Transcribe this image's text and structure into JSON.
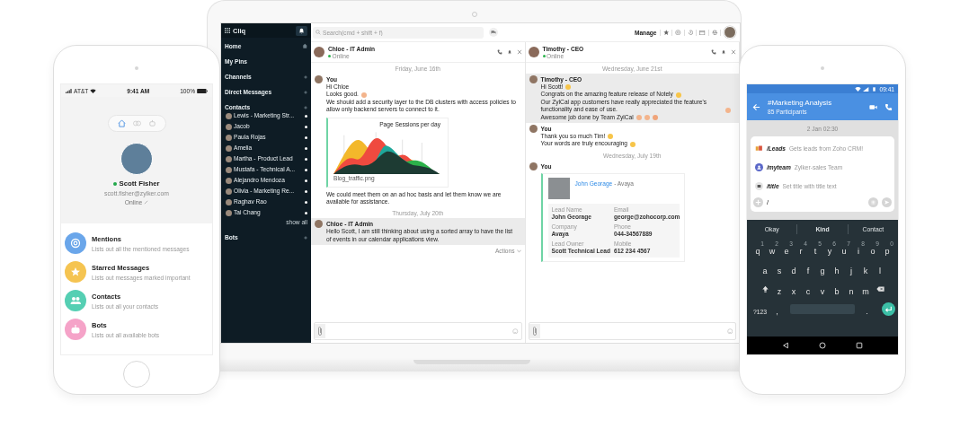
{
  "left_phone": {
    "status_bar": {
      "carrier": "AT&T",
      "time": "9:41 AM",
      "battery": "100%"
    },
    "tabs": [
      {
        "kind": "home",
        "selected": true
      },
      {
        "kind": "chats",
        "selected": false
      },
      {
        "kind": "bots",
        "selected": false
      }
    ],
    "profile": {
      "name": "Scott Fisher",
      "online": true,
      "email": "scott.fisher@zylker.com",
      "status": "Online"
    },
    "menu": [
      {
        "kind": "mentions",
        "title": "Mentions",
        "subtitle": "Lists out all the mentioned messages",
        "color": "#6aa6ea"
      },
      {
        "kind": "starred",
        "title": "Starred Messages",
        "subtitle": "Lists out messages marked important",
        "color": "#f5c451"
      },
      {
        "kind": "contacts",
        "title": "Contacts",
        "subtitle": "Lists out all your contacts",
        "color": "#55cfb3"
      },
      {
        "kind": "bots",
        "title": "Bots",
        "subtitle": "Lists out all available bots",
        "color": "#f5a3c8"
      }
    ]
  },
  "laptop": {
    "sidebar": {
      "app_name": "Cliq",
      "items": [
        {
          "kind": "home",
          "label": "Home"
        },
        {
          "kind": "plain",
          "label": "My Pins"
        },
        {
          "kind": "section",
          "label": "Channels"
        },
        {
          "kind": "section",
          "label": "Direct Messages"
        },
        {
          "kind": "section",
          "label": "Contacts",
          "children": [
            {
              "name": "Lewis - Marketing Str..."
            },
            {
              "name": "Jacob"
            },
            {
              "name": "Paula Rojas"
            },
            {
              "name": "Amelia"
            },
            {
              "name": "Martha - Product Lead"
            },
            {
              "name": "Mustafa - Technical A..."
            },
            {
              "name": "Alejandro Mendoza"
            },
            {
              "name": "Olivia - Marketing Re..."
            },
            {
              "name": "Raghav Rao"
            },
            {
              "name": "Tai Chang"
            }
          ],
          "more": "show all"
        },
        {
          "kind": "section",
          "label": "Bots"
        }
      ]
    },
    "toolbar": {
      "search_placeholder": "Search(cmd + shift + f)",
      "manage": "Manage"
    },
    "chats": [
      {
        "contact": "Chloe - IT Admin",
        "status": "Online",
        "actions": "Actions",
        "timeline": [
          {
            "kind": "date",
            "text": "Friday, June 16th"
          },
          {
            "kind": "message",
            "sender": "You",
            "highlighted": false,
            "blocks": [
              {
                "kind": "line",
                "text": "Hi Chloe"
              },
              {
                "kind": "line",
                "text": "Looks good.",
                "emojis": [
                  {
                    "kind": "hand"
                  }
                ]
              },
              {
                "kind": "line",
                "text": "We should add a security layer to the DB clusters with access policies to allow only backend servers to connect to it."
              },
              {
                "kind": "image",
                "title": "Page Sessions per day",
                "file": "Blog_traffic.png"
              },
              {
                "kind": "line",
                "text": "We could meet them on an ad hoc basis and let them know we are available for assistance."
              }
            ]
          },
          {
            "kind": "date",
            "text": "Thursday, July 20th"
          },
          {
            "kind": "message",
            "sender": "Chloe - IT Admin",
            "highlighted": true,
            "blocks": [
              {
                "kind": "line",
                "text": "Hello Scott, I am still thinking about using a sorted array to have the list of events in our calendar applications view."
              }
            ]
          }
        ]
      },
      {
        "contact": "Timothy - CEO",
        "status": "Online",
        "timeline": [
          {
            "kind": "date",
            "text": "Wednesday, June 21st"
          },
          {
            "kind": "message",
            "sender": "Timothy - CEO",
            "highlighted": true,
            "blocks": [
              {
                "kind": "line",
                "text": "Hi Scott!",
                "emojis": [
                  {
                    "kind": "smile"
                  }
                ]
              },
              {
                "kind": "line",
                "text": "Congrats on the amazing feature release of Notely",
                "emojis": [
                  {
                    "kind": "cool"
                  }
                ]
              },
              {
                "kind": "line",
                "text": "Our ZylCal app customers have really appreciated the feature's functionality and ease of use.",
                "emojis": [
                  {
                    "kind": "clap"
                  }
                ]
              },
              {
                "kind": "line",
                "text": "Awesome job done by Team ZylCal",
                "emojis": [
                  {
                    "kind": "hand"
                  },
                  {
                    "kind": "clap"
                  },
                  {
                    "kind": "party"
                  }
                ]
              }
            ]
          },
          {
            "kind": "message",
            "sender": "You",
            "highlighted": false,
            "blocks": [
              {
                "kind": "line",
                "text": "Thank you so much Tim!",
                "emojis": [
                  {
                    "kind": "smile"
                  }
                ]
              },
              {
                "kind": "line",
                "text": "Your words are truly encouraging",
                "emojis": [
                  {
                    "kind": "angel"
                  }
                ]
              }
            ]
          },
          {
            "kind": "date",
            "text": "Wednesday, July 19th"
          },
          {
            "kind": "message",
            "sender": "You",
            "highlighted": false,
            "blocks": [
              {
                "kind": "lead_card",
                "name": "John Georage",
                "company": "- Avaya",
                "fields": [
                  {
                    "label": "Lead Name",
                    "value": "John Georage"
                  },
                  {
                    "label": "Email",
                    "value": "george@zohocorp.com"
                  },
                  {
                    "label": "Company",
                    "value": "Avaya"
                  },
                  {
                    "label": "Phone",
                    "value": "044-34567889"
                  },
                  {
                    "label": "Lead Owner",
                    "value": "Scott Technical Lead"
                  },
                  {
                    "label": "Mobile",
                    "value": "612 234 4567"
                  }
                ]
              }
            ]
          }
        ]
      }
    ]
  },
  "right_phone": {
    "status_bar": {
      "time": "09:41"
    },
    "header": {
      "title": "#Marketing Analysis",
      "subtitle": "85 Participants"
    },
    "date": "2 Jan 02:30",
    "commands": [
      {
        "kind": "crm",
        "command": "/Leads",
        "description": "Gets leads from Zoho CRM!"
      },
      {
        "kind": "team",
        "command": "/myteam",
        "description": "Zylker-sales Team"
      },
      {
        "kind": "title",
        "command": "/title",
        "description": "Set title with title text"
      }
    ],
    "input": {
      "value": "/"
    },
    "keyboard": {
      "suggestions": [
        {
          "text": "Okay",
          "selected": false
        },
        {
          "text": "Kind",
          "selected": true
        },
        {
          "text": "Contact",
          "selected": false
        }
      ],
      "rows": [
        {
          "keys": [
            {
              "kind": "char",
              "key": "q",
              "hint": "1"
            },
            {
              "kind": "char",
              "key": "w",
              "hint": "2"
            },
            {
              "kind": "char",
              "key": "e",
              "hint": "3"
            },
            {
              "kind": "char",
              "key": "r",
              "hint": "4"
            },
            {
              "kind": "char",
              "key": "t",
              "hint": "5"
            },
            {
              "kind": "char",
              "key": "y",
              "hint": "6"
            },
            {
              "kind": "char",
              "key": "u",
              "hint": "7"
            },
            {
              "kind": "char",
              "key": "i",
              "hint": "8"
            },
            {
              "kind": "char",
              "key": "o",
              "hint": "9"
            },
            {
              "kind": "char",
              "key": "p",
              "hint": "0"
            }
          ]
        },
        {
          "keys": [
            {
              "kind": "char",
              "key": "a"
            },
            {
              "kind": "char",
              "key": "s"
            },
            {
              "kind": "char",
              "key": "d"
            },
            {
              "kind": "char",
              "key": "f"
            },
            {
              "kind": "char",
              "key": "g"
            },
            {
              "kind": "char",
              "key": "h"
            },
            {
              "kind": "char",
              "key": "j"
            },
            {
              "kind": "char",
              "key": "k"
            },
            {
              "kind": "char",
              "key": "l"
            }
          ]
        },
        {
          "keys": [
            {
              "kind": "shift"
            },
            {
              "kind": "char",
              "key": "z"
            },
            {
              "kind": "char",
              "key": "x"
            },
            {
              "kind": "char",
              "key": "c"
            },
            {
              "kind": "char",
              "key": "v"
            },
            {
              "kind": "char",
              "key": "b"
            },
            {
              "kind": "char",
              "key": "n"
            },
            {
              "kind": "char",
              "key": "m"
            },
            {
              "kind": "backspace"
            }
          ]
        },
        {
          "keys": [
            {
              "kind": "char",
              "key": "?123"
            },
            {
              "kind": "char",
              "key": ","
            },
            {
              "kind": "space"
            },
            {
              "kind": "char",
              "key": "."
            },
            {
              "kind": "enter"
            }
          ]
        }
      ]
    }
  }
}
